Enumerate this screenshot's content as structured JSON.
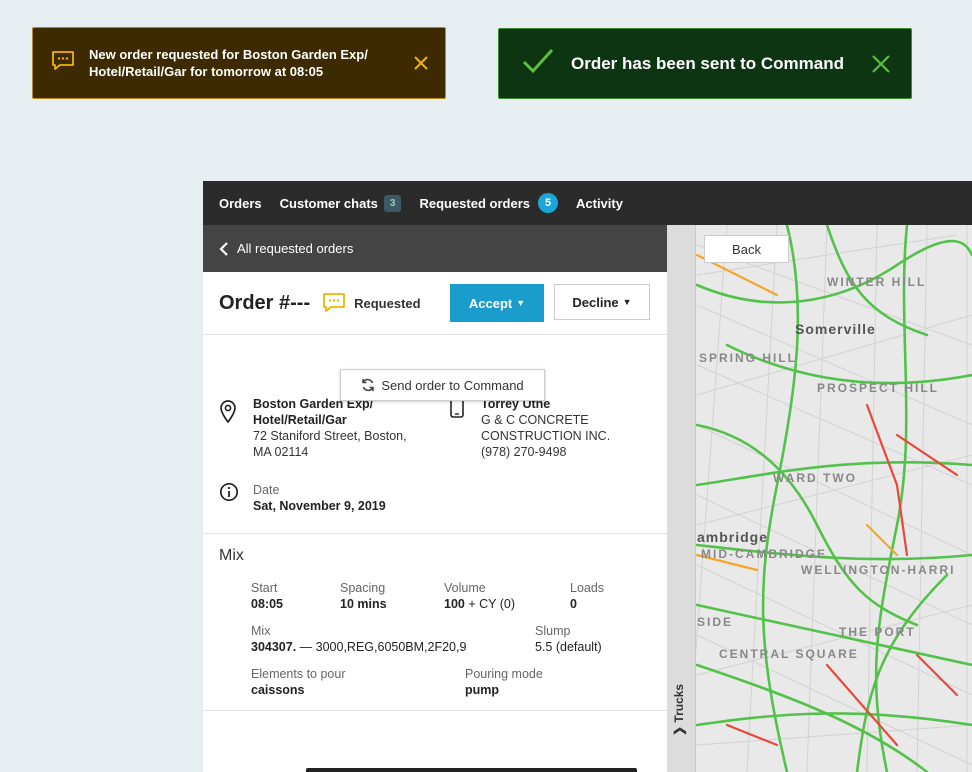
{
  "toasts": {
    "new_order": {
      "text": "New order requested for Boston Garden Exp/ Hotel/Retail/Gar for tomorrow at 08:05",
      "accent": "#f0b400"
    },
    "sent": {
      "text": "Order has been sent to Command",
      "accent": "#5fbd3f"
    }
  },
  "nav": {
    "orders": "Orders",
    "customer_chats": "Customer chats",
    "customer_chats_count": "3",
    "requested_orders": "Requested orders",
    "requested_orders_count": "5",
    "activity": "Activity"
  },
  "subheader": {
    "back_label": "All requested orders"
  },
  "order": {
    "title": "Order #---",
    "status": "Requested",
    "accept_label": "Accept",
    "decline_label": "Decline",
    "dropdown_item": "Send order to Command"
  },
  "location": {
    "name_line1": "Boston Garden Exp/",
    "name_line2": "Hotel/Retail/Gar",
    "address_line1": "72 Staniford Street, Boston,",
    "address_line2": "MA 02114"
  },
  "contact": {
    "name": "Torrey Uthe",
    "company_line1": "G & C CONCRETE",
    "company_line2": "CONSTRUCTION INC.",
    "phone": "(978) 270-9498"
  },
  "date": {
    "label": "Date",
    "value": "Sat, November 9, 2019"
  },
  "mix": {
    "title": "Mix",
    "start_label": "Start",
    "start_value": "08:05",
    "spacing_label": "Spacing",
    "spacing_value": "10 mins",
    "volume_label": "Volume",
    "volume_value": "100",
    "volume_unit": "+ CY (0)",
    "loads_label": "Loads",
    "loads_value": "0",
    "mix_label": "Mix",
    "mix_code": "304307.",
    "mix_desc": "— 3000,REG,6050BM,2F20,9",
    "slump_label": "Slump",
    "slump_value": "5.5 (default)",
    "elements_label": "Elements to pour",
    "elements_value": "caissons",
    "pouring_label": "Pouring mode",
    "pouring_value": "pump"
  },
  "map": {
    "back_label": "Back",
    "trucks_label": "Trucks",
    "labels": [
      "WINTER HILL",
      "Somerville",
      "SPRING HILL",
      "PROSPECT HILL",
      "WARD TWO",
      "ambridge",
      "MID-CAMBRIDGE",
      "WELLINGTON-HARRI",
      "SIDE",
      "THE PORT",
      "CENTRAL SQUARE"
    ]
  }
}
